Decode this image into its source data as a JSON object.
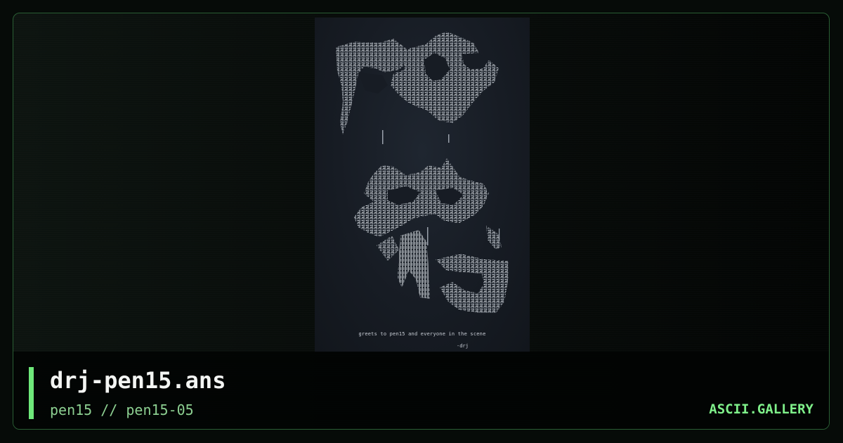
{
  "artwork": {
    "greets_text": "greets to pen15 and everyone in the scene",
    "signature": "-drj"
  },
  "footer": {
    "title": "drj-pen15.ans",
    "subtitle": "pen15 // pen15-05",
    "brand": "ASCII.GALLERY"
  },
  "colors": {
    "accent": "#6ee87a",
    "border": "#2a5e34",
    "art_fg": "#c9ced6"
  }
}
